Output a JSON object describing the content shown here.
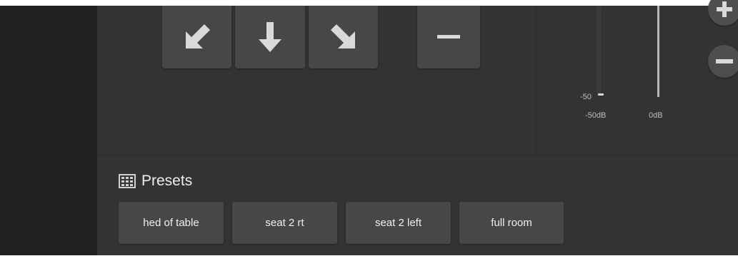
{
  "camera_controls": {
    "pan_down_left": {
      "icon": "arrow-down-left-icon"
    },
    "pan_down": {
      "icon": "arrow-down-icon"
    },
    "pan_down_right": {
      "icon": "arrow-down-right-icon"
    },
    "zoom_out": {
      "icon": "minus-icon"
    }
  },
  "audio": {
    "meter_scale_min": "-50",
    "channels": [
      {
        "label": "-50dB"
      },
      {
        "label": "0dB"
      }
    ],
    "volume_up_icon": "plus-icon",
    "volume_down_icon": "minus-icon"
  },
  "presets": {
    "title": "Presets",
    "icon": "grid-keypad-icon",
    "items": [
      {
        "label": "hed of table"
      },
      {
        "label": "seat 2 rt"
      },
      {
        "label": "seat 2 left"
      },
      {
        "label": "full room"
      }
    ]
  },
  "colors": {
    "panel_bg": "#333333",
    "sidebar_bg": "#222222",
    "button_bg": "#474747",
    "icon_color": "#d9d9d9"
  }
}
